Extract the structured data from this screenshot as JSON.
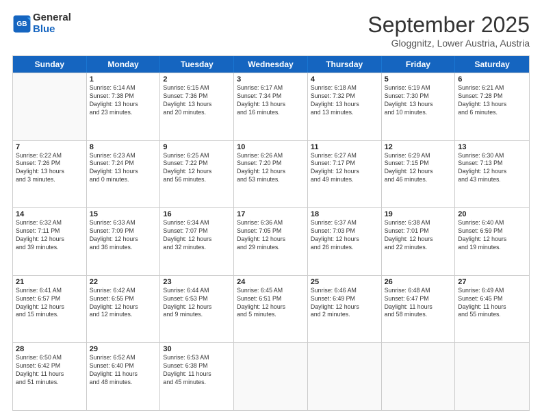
{
  "logo": {
    "line1": "General",
    "line2": "Blue"
  },
  "title": "September 2025",
  "subtitle": "Gloggnitz, Lower Austria, Austria",
  "header_days": [
    "Sunday",
    "Monday",
    "Tuesday",
    "Wednesday",
    "Thursday",
    "Friday",
    "Saturday"
  ],
  "rows": [
    [
      {
        "day": "",
        "info": ""
      },
      {
        "day": "1",
        "info": "Sunrise: 6:14 AM\nSunset: 7:38 PM\nDaylight: 13 hours\nand 23 minutes."
      },
      {
        "day": "2",
        "info": "Sunrise: 6:15 AM\nSunset: 7:36 PM\nDaylight: 13 hours\nand 20 minutes."
      },
      {
        "day": "3",
        "info": "Sunrise: 6:17 AM\nSunset: 7:34 PM\nDaylight: 13 hours\nand 16 minutes."
      },
      {
        "day": "4",
        "info": "Sunrise: 6:18 AM\nSunset: 7:32 PM\nDaylight: 13 hours\nand 13 minutes."
      },
      {
        "day": "5",
        "info": "Sunrise: 6:19 AM\nSunset: 7:30 PM\nDaylight: 13 hours\nand 10 minutes."
      },
      {
        "day": "6",
        "info": "Sunrise: 6:21 AM\nSunset: 7:28 PM\nDaylight: 13 hours\nand 6 minutes."
      }
    ],
    [
      {
        "day": "7",
        "info": "Sunrise: 6:22 AM\nSunset: 7:26 PM\nDaylight: 13 hours\nand 3 minutes."
      },
      {
        "day": "8",
        "info": "Sunrise: 6:23 AM\nSunset: 7:24 PM\nDaylight: 13 hours\nand 0 minutes."
      },
      {
        "day": "9",
        "info": "Sunrise: 6:25 AM\nSunset: 7:22 PM\nDaylight: 12 hours\nand 56 minutes."
      },
      {
        "day": "10",
        "info": "Sunrise: 6:26 AM\nSunset: 7:20 PM\nDaylight: 12 hours\nand 53 minutes."
      },
      {
        "day": "11",
        "info": "Sunrise: 6:27 AM\nSunset: 7:17 PM\nDaylight: 12 hours\nand 49 minutes."
      },
      {
        "day": "12",
        "info": "Sunrise: 6:29 AM\nSunset: 7:15 PM\nDaylight: 12 hours\nand 46 minutes."
      },
      {
        "day": "13",
        "info": "Sunrise: 6:30 AM\nSunset: 7:13 PM\nDaylight: 12 hours\nand 43 minutes."
      }
    ],
    [
      {
        "day": "14",
        "info": "Sunrise: 6:32 AM\nSunset: 7:11 PM\nDaylight: 12 hours\nand 39 minutes."
      },
      {
        "day": "15",
        "info": "Sunrise: 6:33 AM\nSunset: 7:09 PM\nDaylight: 12 hours\nand 36 minutes."
      },
      {
        "day": "16",
        "info": "Sunrise: 6:34 AM\nSunset: 7:07 PM\nDaylight: 12 hours\nand 32 minutes."
      },
      {
        "day": "17",
        "info": "Sunrise: 6:36 AM\nSunset: 7:05 PM\nDaylight: 12 hours\nand 29 minutes."
      },
      {
        "day": "18",
        "info": "Sunrise: 6:37 AM\nSunset: 7:03 PM\nDaylight: 12 hours\nand 26 minutes."
      },
      {
        "day": "19",
        "info": "Sunrise: 6:38 AM\nSunset: 7:01 PM\nDaylight: 12 hours\nand 22 minutes."
      },
      {
        "day": "20",
        "info": "Sunrise: 6:40 AM\nSunset: 6:59 PM\nDaylight: 12 hours\nand 19 minutes."
      }
    ],
    [
      {
        "day": "21",
        "info": "Sunrise: 6:41 AM\nSunset: 6:57 PM\nDaylight: 12 hours\nand 15 minutes."
      },
      {
        "day": "22",
        "info": "Sunrise: 6:42 AM\nSunset: 6:55 PM\nDaylight: 12 hours\nand 12 minutes."
      },
      {
        "day": "23",
        "info": "Sunrise: 6:44 AM\nSunset: 6:53 PM\nDaylight: 12 hours\nand 9 minutes."
      },
      {
        "day": "24",
        "info": "Sunrise: 6:45 AM\nSunset: 6:51 PM\nDaylight: 12 hours\nand 5 minutes."
      },
      {
        "day": "25",
        "info": "Sunrise: 6:46 AM\nSunset: 6:49 PM\nDaylight: 12 hours\nand 2 minutes."
      },
      {
        "day": "26",
        "info": "Sunrise: 6:48 AM\nSunset: 6:47 PM\nDaylight: 11 hours\nand 58 minutes."
      },
      {
        "day": "27",
        "info": "Sunrise: 6:49 AM\nSunset: 6:45 PM\nDaylight: 11 hours\nand 55 minutes."
      }
    ],
    [
      {
        "day": "28",
        "info": "Sunrise: 6:50 AM\nSunset: 6:42 PM\nDaylight: 11 hours\nand 51 minutes."
      },
      {
        "day": "29",
        "info": "Sunrise: 6:52 AM\nSunset: 6:40 PM\nDaylight: 11 hours\nand 48 minutes."
      },
      {
        "day": "30",
        "info": "Sunrise: 6:53 AM\nSunset: 6:38 PM\nDaylight: 11 hours\nand 45 minutes."
      },
      {
        "day": "",
        "info": ""
      },
      {
        "day": "",
        "info": ""
      },
      {
        "day": "",
        "info": ""
      },
      {
        "day": "",
        "info": ""
      }
    ]
  ]
}
